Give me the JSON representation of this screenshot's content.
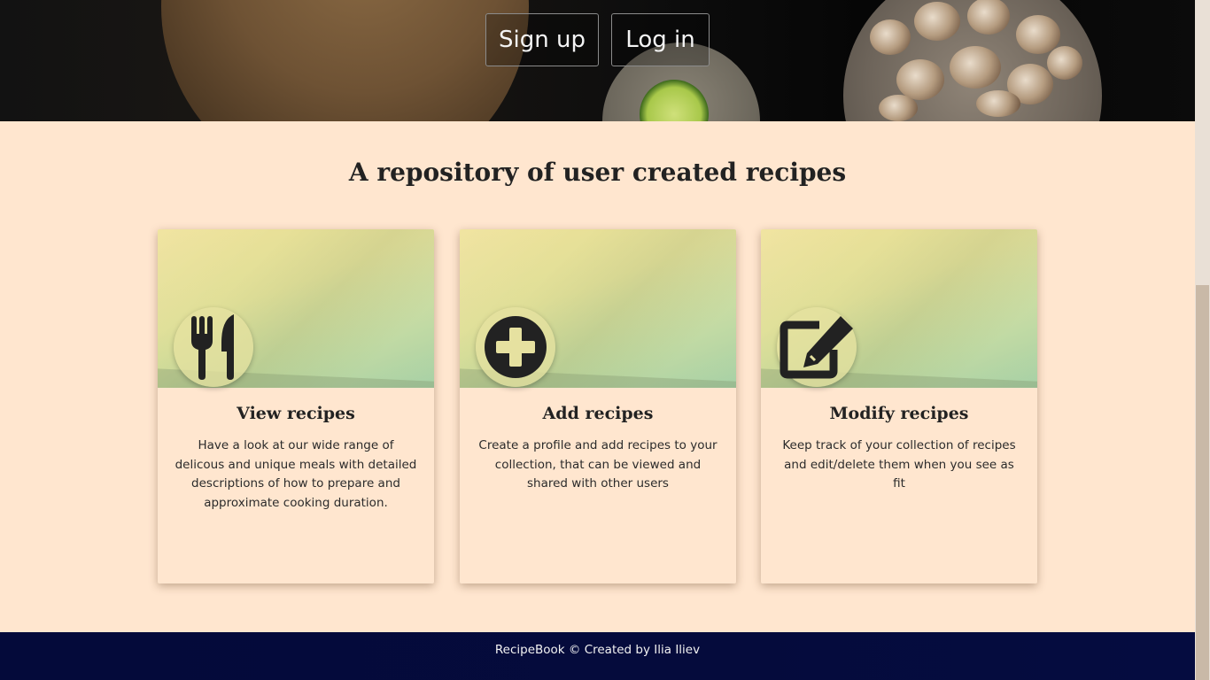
{
  "header": {
    "signup_label": "Sign up",
    "login_label": "Log in"
  },
  "main": {
    "headline": "A repository of user created recipes",
    "cards": [
      {
        "icon": "fork-knife-icon",
        "title": "View recipes",
        "text": "Have a look at our wide range of delicous and unique meals with detailed descriptions of how to prepare and approximate cooking duration."
      },
      {
        "icon": "plus-circle-icon",
        "title": "Add recipes",
        "text": "Create a profile and add recipes to your collection, that can be viewed and shared with other users"
      },
      {
        "icon": "edit-icon",
        "title": "Modify recipes",
        "text": "Keep track of your collection of recipes and edit/delete them when you see as fit"
      }
    ]
  },
  "footer": {
    "text": "RecipeBook © Created by Ilia Iliev"
  },
  "colors": {
    "page_background": "#ffe6cf",
    "footer_background": "#050b3c",
    "icon_color": "#222222"
  }
}
